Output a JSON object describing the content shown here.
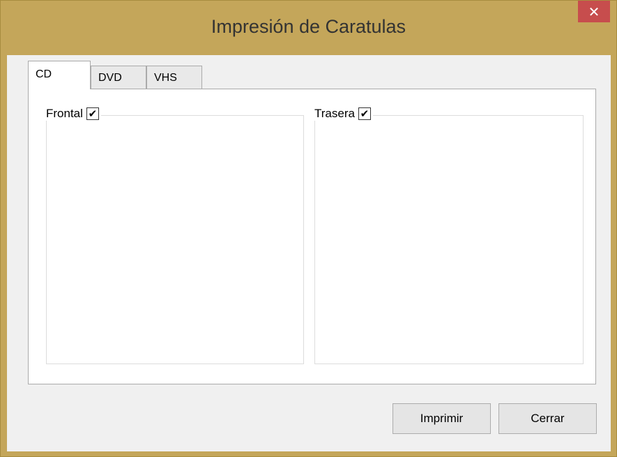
{
  "window": {
    "title": "Impresión de Caratulas",
    "close_glyph": "✕"
  },
  "tabs": [
    {
      "label": "CD",
      "active": true
    },
    {
      "label": "DVD",
      "active": false
    },
    {
      "label": "VHS",
      "active": false
    }
  ],
  "groups": {
    "front": {
      "label": "Frontal",
      "checked": true,
      "check_glyph": "✔"
    },
    "back": {
      "label": "Trasera",
      "checked": true,
      "check_glyph": "✔"
    }
  },
  "buttons": {
    "print_label": "Imprimir",
    "close_label": "Cerrar"
  },
  "colors": {
    "frame": "#c4a65a",
    "close_button": "#c74d4d"
  }
}
